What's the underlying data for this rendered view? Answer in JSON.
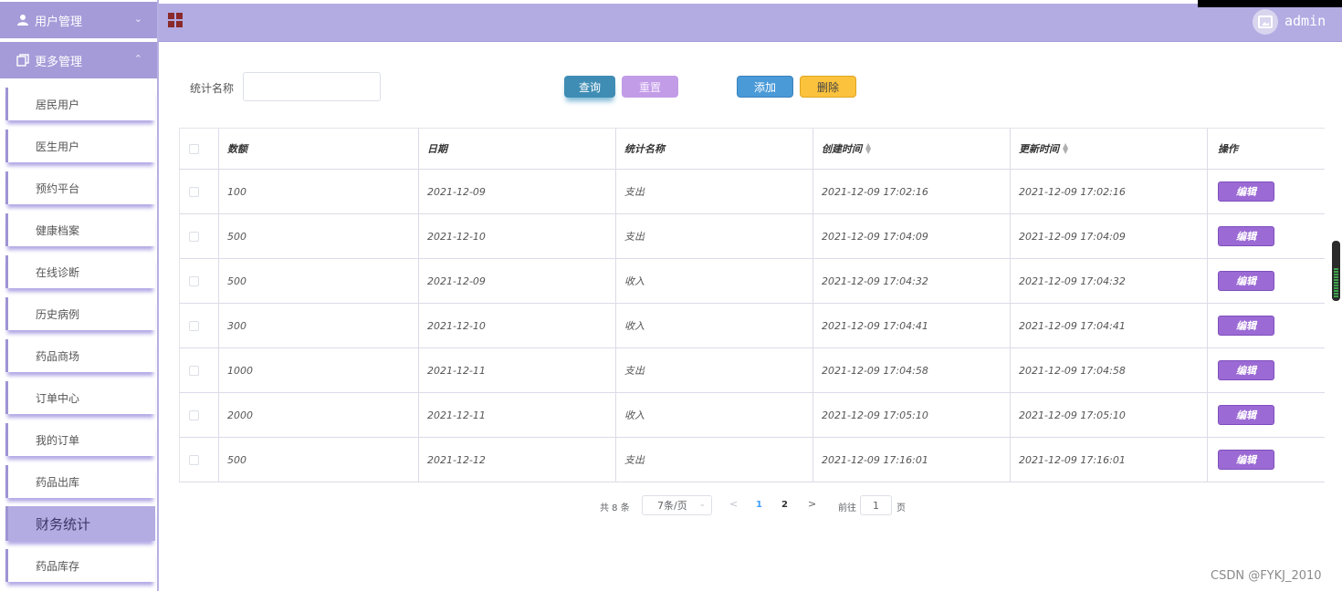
{
  "sidebar": {
    "groups": [
      {
        "label": "用户管理",
        "icon": "user-icon"
      },
      {
        "label": "更多管理",
        "icon": "copy-icon"
      }
    ],
    "items": [
      {
        "label": "居民用户"
      },
      {
        "label": "医生用户"
      },
      {
        "label": "预约平台"
      },
      {
        "label": "健康档案"
      },
      {
        "label": "在线诊断"
      },
      {
        "label": "历史病例"
      },
      {
        "label": "药品商场"
      },
      {
        "label": "订单中心"
      },
      {
        "label": "我的订单"
      },
      {
        "label": "药品出库"
      },
      {
        "label": "财务统计",
        "active": true
      },
      {
        "label": "药品库存"
      }
    ]
  },
  "header": {
    "username": "admin",
    "menu_icon": "grid-icon",
    "avatar_icon": "image-icon"
  },
  "search": {
    "label": "统计名称",
    "value": "",
    "query_label": "查询",
    "reset_label": "重置",
    "add_label": "添加",
    "delete_label": "删除"
  },
  "table": {
    "columns": [
      "数额",
      "日期",
      "统计名称",
      "创建时间",
      "更新时间",
      "操作"
    ],
    "edit_label": "编辑",
    "rows": [
      {
        "amount": "100",
        "date": "2021-12-09",
        "name": "支出",
        "created": "2021-12-09 17:02:16",
        "updated": "2021-12-09 17:02:16"
      },
      {
        "amount": "500",
        "date": "2021-12-10",
        "name": "支出",
        "created": "2021-12-09 17:04:09",
        "updated": "2021-12-09 17:04:09"
      },
      {
        "amount": "500",
        "date": "2021-12-09",
        "name": "收入",
        "created": "2021-12-09 17:04:32",
        "updated": "2021-12-09 17:04:32"
      },
      {
        "amount": "300",
        "date": "2021-12-10",
        "name": "收入",
        "created": "2021-12-09 17:04:41",
        "updated": "2021-12-09 17:04:41"
      },
      {
        "amount": "1000",
        "date": "2021-12-11",
        "name": "支出",
        "created": "2021-12-09 17:04:58",
        "updated": "2021-12-09 17:04:58"
      },
      {
        "amount": "2000",
        "date": "2021-12-11",
        "name": "收入",
        "created": "2021-12-09 17:05:10",
        "updated": "2021-12-09 17:05:10"
      },
      {
        "amount": "500",
        "date": "2021-12-12",
        "name": "支出",
        "created": "2021-12-09 17:16:01",
        "updated": "2021-12-09 17:16:01"
      }
    ]
  },
  "pagination": {
    "total": "共 8 条",
    "page_size": "7条/页",
    "pages": [
      "1",
      "2"
    ],
    "current": "1",
    "goto_label": "前往",
    "goto_value": "1",
    "page_suffix": "页"
  },
  "watermark": "CSDN @FYKJ_2010",
  "colors": {
    "theme": "#b2ace3",
    "sidebar_head": "#a59bd8",
    "query": "#3f8db4",
    "reset": "#c39ce7",
    "add": "#4a9ad8",
    "delete": "#fbc23d",
    "edit": "#9b6ad4"
  }
}
